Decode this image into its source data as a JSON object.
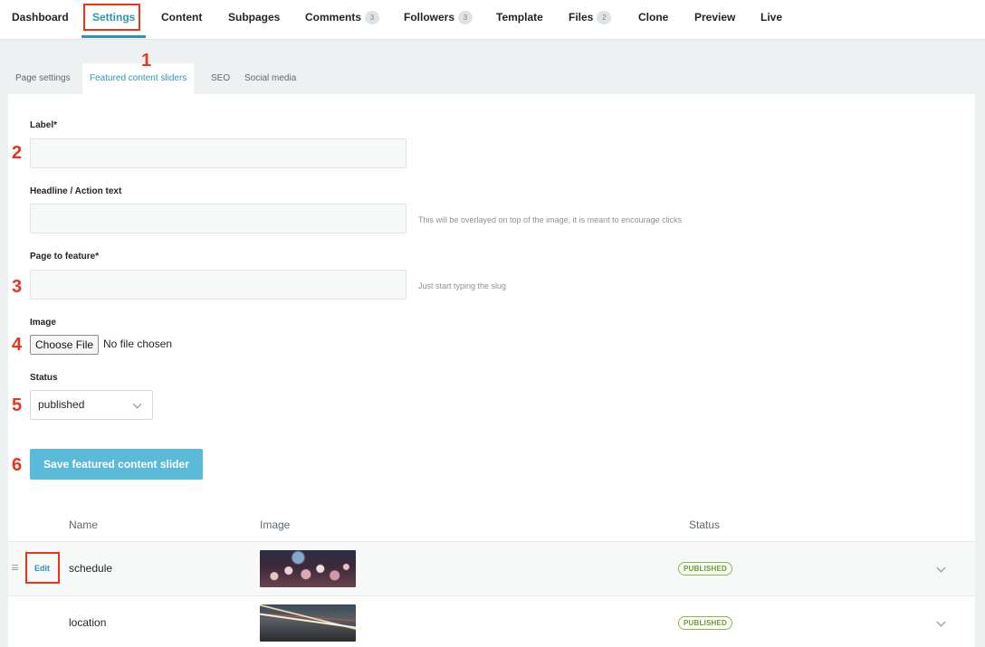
{
  "nav": {
    "items": [
      {
        "label": "Dashboard"
      },
      {
        "label": "Settings",
        "active": true
      },
      {
        "label": "Content"
      },
      {
        "label": "Subpages"
      },
      {
        "label": "Comments",
        "badge": "3"
      },
      {
        "label": "Followers",
        "badge": "3"
      },
      {
        "label": "Template"
      },
      {
        "label": "Files",
        "badge": "2"
      },
      {
        "label": "Clone"
      },
      {
        "label": "Preview"
      },
      {
        "label": "Live"
      }
    ]
  },
  "subtabs": [
    {
      "label": "Page settings"
    },
    {
      "label": "Featured content sliders",
      "active": true
    },
    {
      "label": "SEO"
    },
    {
      "label": "Social media"
    }
  ],
  "form": {
    "label_field": {
      "label": "Label*",
      "value": ""
    },
    "headline_field": {
      "label": "Headline / Action text",
      "value": "",
      "help": "This will be overlayed on top of the image, it is meant to encourage clicks"
    },
    "page_field": {
      "label": "Page to feature*",
      "value": "",
      "help": "Just start typing the slug"
    },
    "image_field": {
      "label": "Image",
      "button": "Choose File",
      "status": "No file chosen"
    },
    "status_field": {
      "label": "Status",
      "selected": "published"
    },
    "save_button": "Save featured content slider"
  },
  "table": {
    "headers": {
      "name": "Name",
      "image": "Image",
      "status": "Status"
    },
    "rows": [
      {
        "edit": "Edit",
        "name": "schedule",
        "image": "crowd photo",
        "status": "PUBLISHED"
      },
      {
        "edit": "Edit",
        "name": "location",
        "image": "night traffic photo",
        "status": "PUBLISHED"
      }
    ]
  },
  "annotations": [
    "1",
    "2",
    "3",
    "4",
    "5",
    "6"
  ],
  "colors": {
    "accent": "#2f95b5",
    "button": "#5bbad8",
    "published": "#6e9c2c",
    "annotation": "#e8341c"
  }
}
